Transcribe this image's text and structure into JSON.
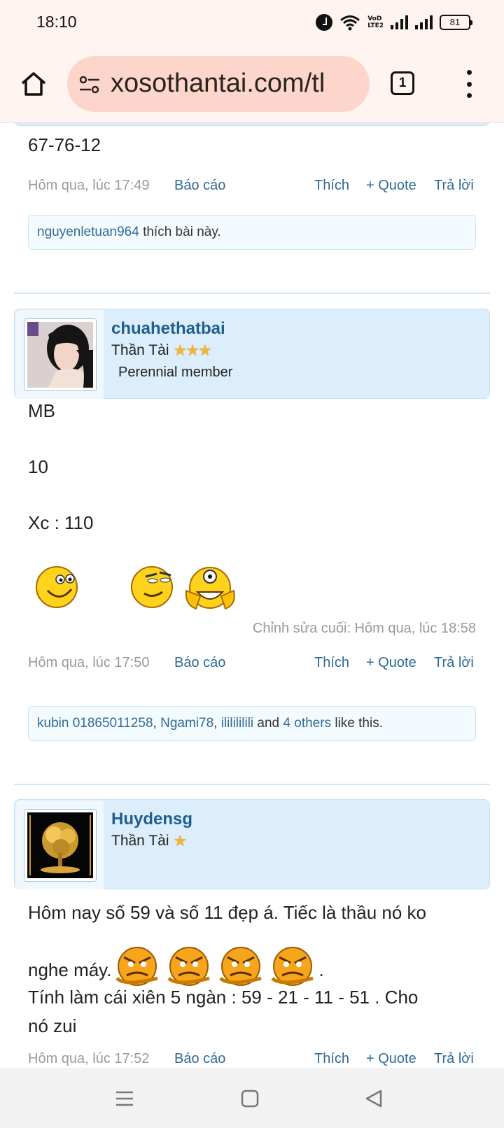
{
  "status_bar": {
    "time": "18:10",
    "volte_line1": "VoD",
    "volte_line2": "LTE2",
    "battery": "81",
    "icons": [
      "alarm-icon",
      "wifi-icon",
      "volte-icon",
      "signal-icon",
      "signal-icon",
      "battery-icon"
    ]
  },
  "browser": {
    "url": "xosothantai.com/tl",
    "tab_count": "1",
    "icons": [
      "home-icon",
      "site-settings-icon",
      "tab-switcher-icon",
      "more-menu-icon"
    ]
  },
  "posts": [
    {
      "body_lines": [
        "67-76-12"
      ],
      "time": "Hôm qua, lúc 17:49",
      "report": "Báo cáo",
      "like": "Thích",
      "quote": "+ Quote",
      "reply": "Trả lời",
      "likes": {
        "users": [
          "nguyenletuan964"
        ],
        "suffix": " thích bài này."
      }
    },
    {
      "username": "chuahethatbai",
      "title": "Thần Tài",
      "stars": "★★★",
      "note": "Perennial member",
      "body_lines": [
        "MB",
        "10",
        "Xc : 110"
      ],
      "edited": "Chỉnh sửa cuối: Hôm qua, lúc 18:58",
      "time": "Hôm qua, lúc 17:50",
      "report": "Báo cáo",
      "like": "Thích",
      "quote": "+ Quote",
      "reply": "Trả lời",
      "likes": {
        "users": [
          "kubin 01865011258",
          "Ngami78",
          "ililililili"
        ],
        "sep": ", ",
        "and": " and ",
        "others": "4 others",
        "suffix": " like this."
      }
    },
    {
      "username": "Huydensg",
      "title": "Thần Tài",
      "stars": "★",
      "body_line1": "Hôm nay số 59 và số 11 đẹp á. Tiếc là thầu nó ko",
      "body_line2": "nghe máy.",
      "body_line2_end": ".",
      "body_line3": "Tính làm cái xiên 5 ngàn : 59 - 21 - 11 - 51 . Cho",
      "body_line4": "nó zui",
      "time": "Hôm qua, lúc 17:52",
      "report": "Báo cáo",
      "like": "Thích",
      "quote": "+ Quote",
      "reply": "Trả lời"
    }
  ],
  "colors": {
    "link": "#2f6a96",
    "username": "#1f5f8d",
    "user_card_bg": "#dceefb",
    "toolbar_bg": "#fff4ef",
    "url_bar_bg": "#fcd5cb"
  },
  "nav_icons": [
    "recents-icon",
    "home-nav-icon",
    "back-icon"
  ]
}
